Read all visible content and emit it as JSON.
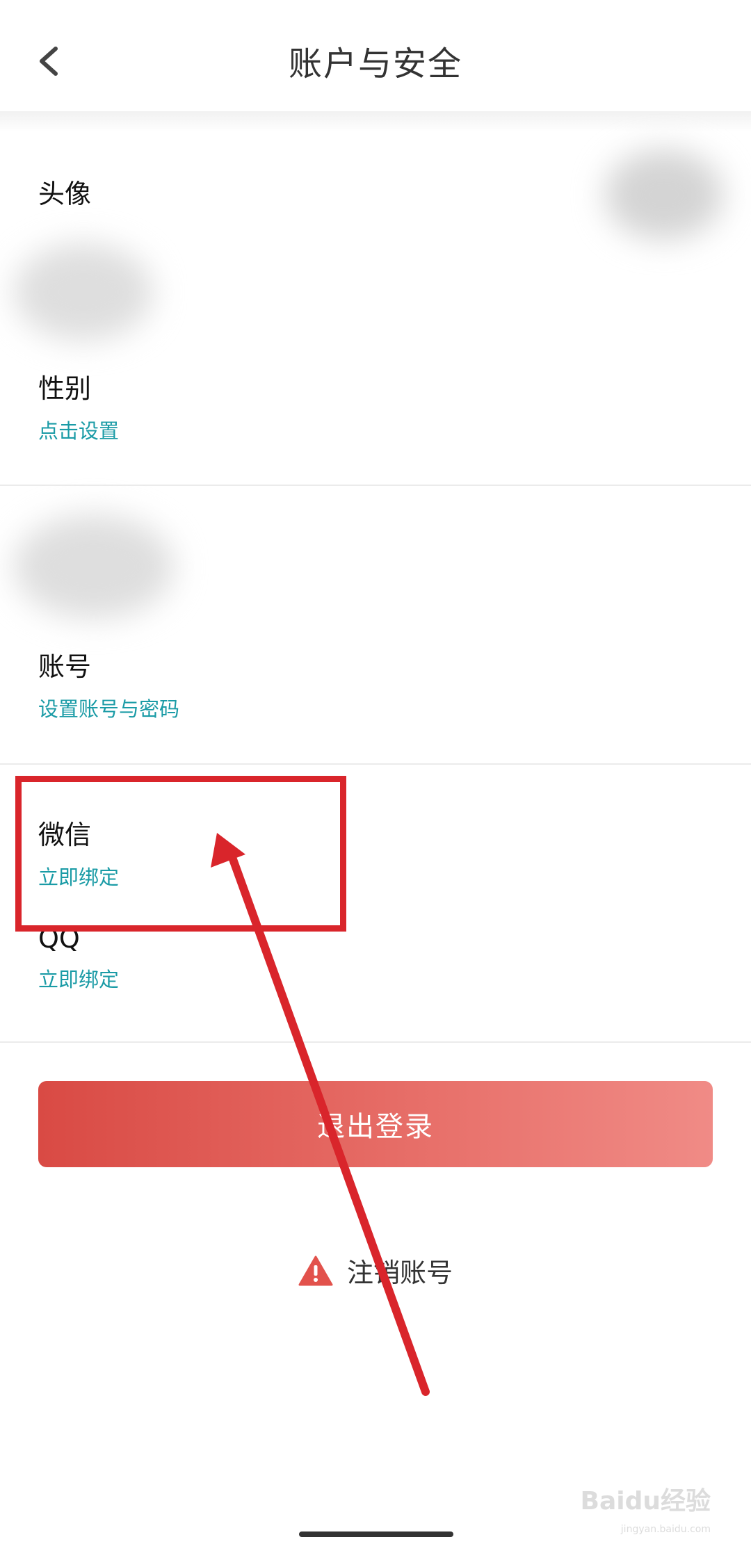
{
  "header": {
    "title": "账户与安全"
  },
  "profile": {
    "avatar_label": "头像",
    "gender_label": "性别",
    "gender_action": "点击设置"
  },
  "account": {
    "label": "账号",
    "action": "设置账号与密码"
  },
  "bindings": {
    "wechat_label": "微信",
    "wechat_action": "立即绑定",
    "qq_label": "QQ",
    "qq_action": "立即绑定"
  },
  "logout": {
    "label": "退出登录"
  },
  "cancel_account": {
    "label": "注销账号",
    "icon": "warning-icon"
  },
  "watermark": {
    "text": "Baidu经验",
    "sub": "jingyan.baidu.com"
  },
  "colors": {
    "link": "#1a9ba6",
    "logout_start": "#d94a44",
    "logout_end": "#f08b86",
    "warning": "#e2524c",
    "annotation": "#d9252b"
  }
}
